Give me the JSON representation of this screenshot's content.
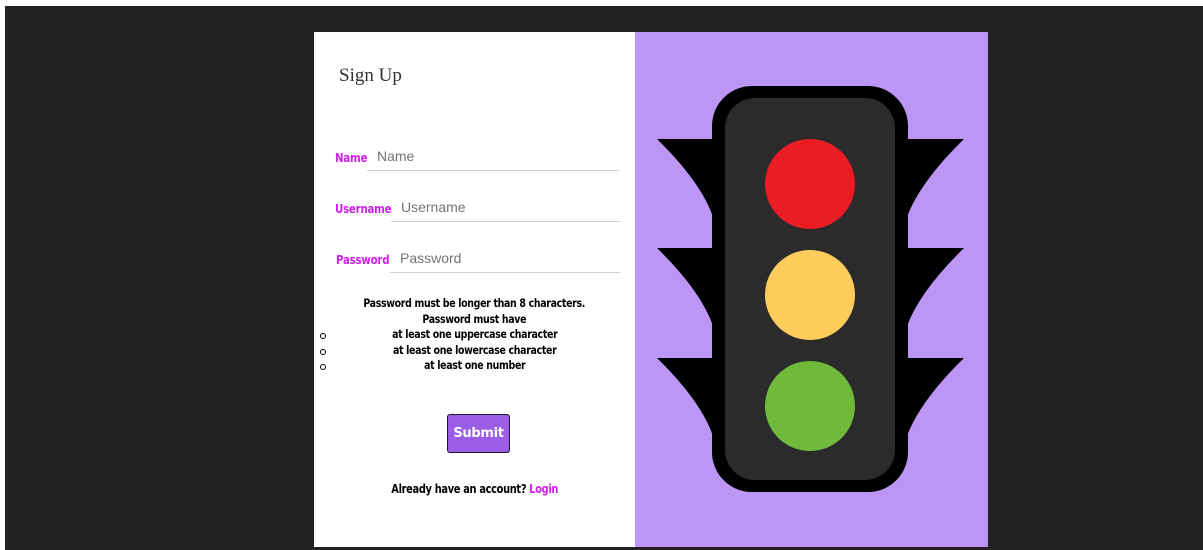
{
  "form": {
    "title": "Sign Up",
    "fields": [
      {
        "label": "Name",
        "placeholder": "Name",
        "value": ""
      },
      {
        "label": "Username",
        "placeholder": "Username",
        "value": ""
      },
      {
        "label": "Password",
        "placeholder": "Password",
        "value": ""
      }
    ],
    "password_rules": {
      "line1": "Password must be longer than 8 characters.",
      "line2": "Password must have",
      "items": [
        "at least one uppercase character",
        "at least one lowercase character",
        "at least one number"
      ]
    },
    "submit_label": "Submit",
    "footer_text": "Already have an account?",
    "login_label": "Login"
  },
  "illustration": {
    "name": "traffic-light-icon",
    "colors": {
      "background": "#bc96f4",
      "housing": "#000000",
      "panel": "#2b2b2b",
      "red": "#ec1c24",
      "yellow": "#ffcd5c",
      "green": "#6fba3a"
    }
  },
  "colors": {
    "page_background": "#222222",
    "accent": "#cc22e6",
    "button": "#9b5de5"
  }
}
